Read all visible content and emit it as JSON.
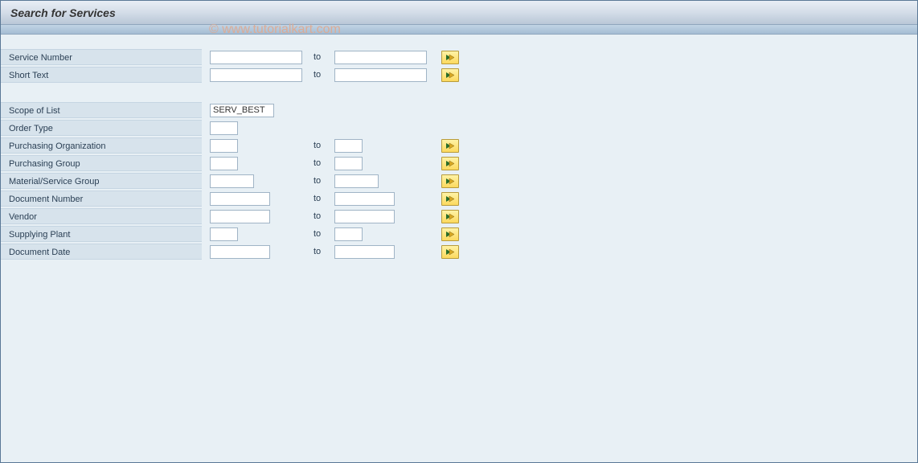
{
  "title": "Search for Services",
  "watermark": "© www.tutorialkart.com",
  "to_label": "to",
  "fields": {
    "service_number": {
      "label": "Service Number",
      "from": "",
      "to": ""
    },
    "short_text": {
      "label": "Short Text",
      "from": "",
      "to": ""
    },
    "scope_of_list": {
      "label": "Scope of List",
      "value": "SERV_BEST"
    },
    "order_type": {
      "label": "Order Type",
      "value": ""
    },
    "purchasing_org": {
      "label": "Purchasing Organization",
      "from": "",
      "to": ""
    },
    "purchasing_group": {
      "label": "Purchasing Group",
      "from": "",
      "to": ""
    },
    "material_service_group": {
      "label": "Material/Service Group",
      "from": "",
      "to": ""
    },
    "document_number": {
      "label": "Document Number",
      "from": "",
      "to": ""
    },
    "vendor": {
      "label": "Vendor",
      "from": "",
      "to": ""
    },
    "supplying_plant": {
      "label": "Supplying Plant",
      "from": "",
      "to": ""
    },
    "document_date": {
      "label": "Document Date",
      "from": "",
      "to": ""
    }
  }
}
